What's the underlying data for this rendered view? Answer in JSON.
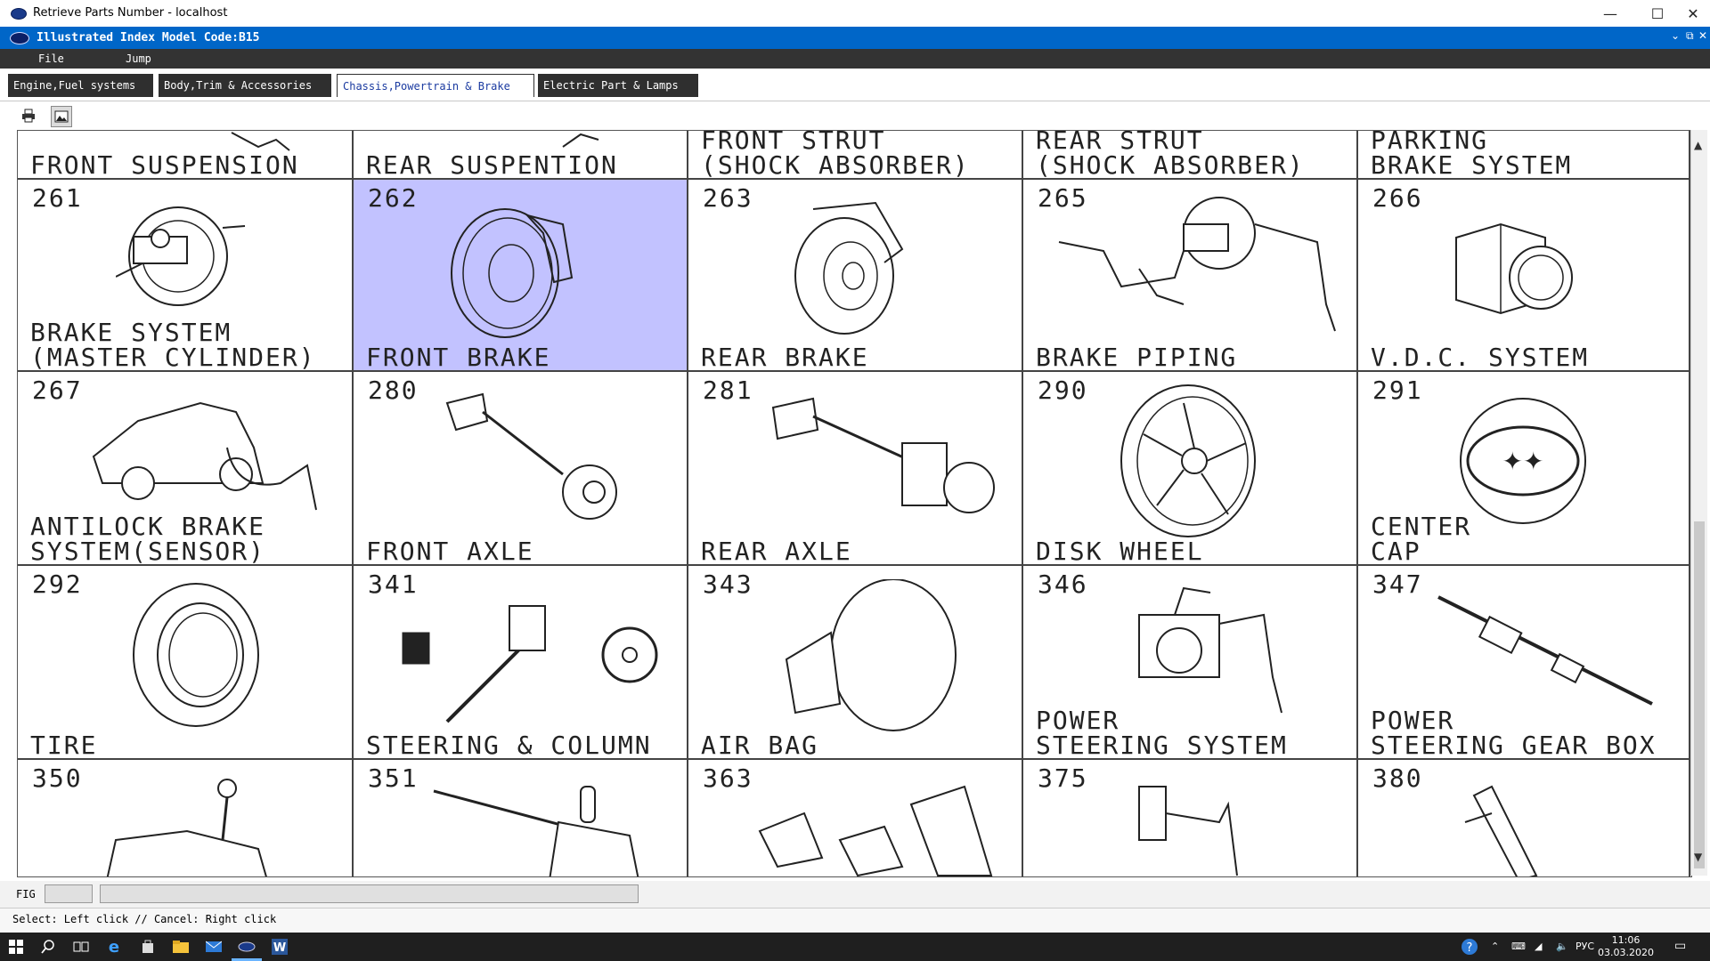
{
  "window": {
    "title": "Retrieve Parts Number - localhost",
    "minimize": "—",
    "maximize": "☐",
    "close": "✕"
  },
  "inner": {
    "title": "Illustrated Index Model Code:B15"
  },
  "menu": {
    "file": "File",
    "jump": "Jump"
  },
  "tabs": [
    {
      "label": "Engine,Fuel systems",
      "active": false
    },
    {
      "label": "Body,Trim & Accessories",
      "active": false
    },
    {
      "label": "Chassis,Powertrain & Brake",
      "active": true
    },
    {
      "label": "Electric Part & Lamps",
      "active": false
    }
  ],
  "toolbar": {
    "print_icon": "printer-icon",
    "image_icon": "image-icon"
  },
  "grid": {
    "top_row": [
      {
        "label": "FRONT SUSPENSION"
      },
      {
        "label": "REAR SUSPENTION"
      },
      {
        "label": "FRONT STRUT\n(SHOCK ABSORBER)"
      },
      {
        "label": "REAR STRUT\n(SHOCK ABSORBER)"
      },
      {
        "label": "PARKING\nBRAKE SYSTEM"
      }
    ],
    "rows": [
      [
        {
          "num": "261",
          "label": "BRAKE SYSTEM\n(MASTER CYLINDER)"
        },
        {
          "num": "262",
          "label": "FRONT BRAKE",
          "selected": true
        },
        {
          "num": "263",
          "label": "REAR BRAKE"
        },
        {
          "num": "265",
          "label": "BRAKE PIPING"
        },
        {
          "num": "266",
          "label": "V.D.C. SYSTEM"
        }
      ],
      [
        {
          "num": "267",
          "label": "ANTILOCK BRAKE\nSYSTEM(SENSOR)"
        },
        {
          "num": "280",
          "label": "FRONT AXLE"
        },
        {
          "num": "281",
          "label": "REAR AXLE"
        },
        {
          "num": "290",
          "label": "DISK WHEEL"
        },
        {
          "num": "291",
          "label": "CENTER\nCAP"
        }
      ],
      [
        {
          "num": "292",
          "label": "TIRE"
        },
        {
          "num": "341",
          "label": "STEERING & COLUMN"
        },
        {
          "num": "343",
          "label": "AIR BAG"
        },
        {
          "num": "346",
          "label": "POWER\nSTEERING SYSTEM"
        },
        {
          "num": "347",
          "label": "POWER\nSTEERING GEAR BOX"
        }
      ],
      [
        {
          "num": "350",
          "label": ""
        },
        {
          "num": "351",
          "label": ""
        },
        {
          "num": "363",
          "label": ""
        },
        {
          "num": "375",
          "label": ""
        },
        {
          "num": "380",
          "label": ""
        }
      ]
    ]
  },
  "figbar": {
    "label": "FIG"
  },
  "status": {
    "text": "Select: Left click // Cancel: Right click"
  },
  "taskbar": {
    "lang": "РУС",
    "time": "11:06",
    "date": "03.03.2020"
  },
  "colors": {
    "accent": "#0066c8",
    "selected": "#c2c2ff",
    "menubar": "#333333"
  }
}
